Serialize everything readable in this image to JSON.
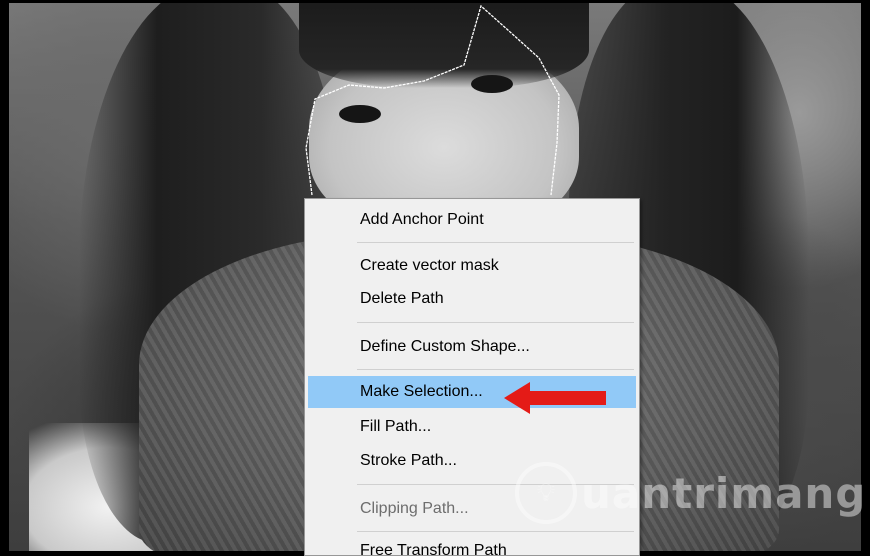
{
  "context_menu": {
    "items": [
      {
        "label": "Add Anchor Point",
        "state": "enabled"
      },
      {
        "label": "Create vector mask",
        "state": "enabled"
      },
      {
        "label": "Delete Path",
        "state": "enabled"
      },
      {
        "label": "Define Custom Shape...",
        "state": "enabled"
      },
      {
        "label": "Make Selection...",
        "state": "highlighted"
      },
      {
        "label": "Fill Path...",
        "state": "enabled"
      },
      {
        "label": "Stroke Path...",
        "state": "enabled"
      },
      {
        "label": "Clipping Path...",
        "state": "disabled"
      },
      {
        "label": "Free Transform Path",
        "state": "enabled"
      }
    ]
  },
  "annotation": {
    "arrow_color": "#e41b17",
    "points_to": "Make Selection..."
  },
  "watermark": {
    "logo_icon": "lightbulb-icon",
    "text": "uantrimang"
  },
  "colors": {
    "menu_bg": "#f0f0f0",
    "highlight": "#91c9f7",
    "disabled_text": "#6d6d6d"
  }
}
